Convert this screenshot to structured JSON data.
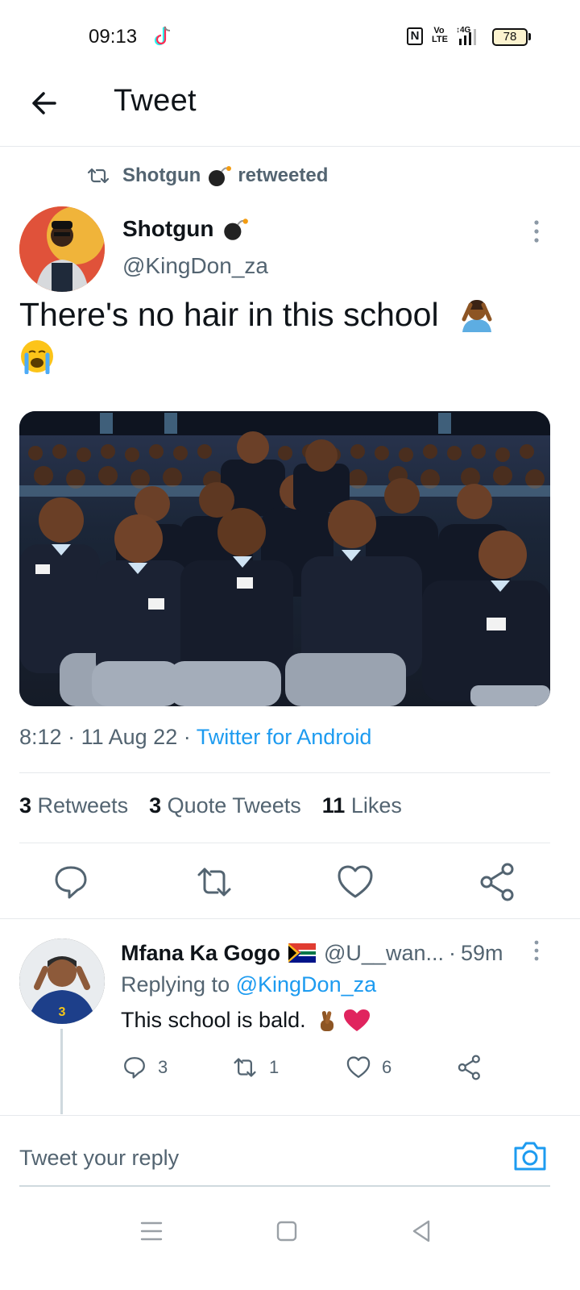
{
  "status_bar": {
    "time": "09:13",
    "network": "4G",
    "volte": "Vo LTE",
    "battery": "78",
    "icons": [
      "tiktok-icon",
      "nfc-icon",
      "signal-icon",
      "battery-icon"
    ]
  },
  "header": {
    "title": "Tweet",
    "back_icon": "arrow-left-icon"
  },
  "retweet_banner": {
    "name": "Shotgun",
    "suffix": "retweeted",
    "icon": "retweet-icon"
  },
  "tweet": {
    "author_name": "Shotgun",
    "author_handle": "@KingDon_za",
    "text": "There's no hair in this school",
    "emojis": [
      "person-facepalm-emoji",
      "crying-face-emoji"
    ],
    "media_alt": "photo of school students in uniforms seated in an auditorium",
    "time": "8:12",
    "date": "11 Aug 22",
    "source": "Twitter for Android",
    "separator": "·"
  },
  "stats": {
    "retweets_count": "3",
    "retweets_label": "Retweets",
    "quotes_count": "3",
    "quotes_label": "Quote Tweets",
    "likes_count": "11",
    "likes_label": "Likes"
  },
  "actions": [
    "reply-icon",
    "retweet-icon",
    "like-icon",
    "share-icon"
  ],
  "reply": {
    "name": "Mfana Ka Gogo",
    "handle": "@U__wan...",
    "dot": "·",
    "time": "59m",
    "replying_prefix": "Replying to",
    "replying_to": "@KingDon_za",
    "text": "This school is bald.",
    "emojis": [
      "crossed-fingers-emoji",
      "red-heart-emoji"
    ],
    "flag": "south-africa-flag",
    "reply_count": "3",
    "retweet_count": "1",
    "like_count": "6"
  },
  "compose": {
    "placeholder": "Tweet your reply",
    "camera_icon": "camera-icon"
  },
  "colors": {
    "accent": "#1d9bf0",
    "text": "#0f1419",
    "secondary": "#536471",
    "divider": "#e6e9ec"
  }
}
